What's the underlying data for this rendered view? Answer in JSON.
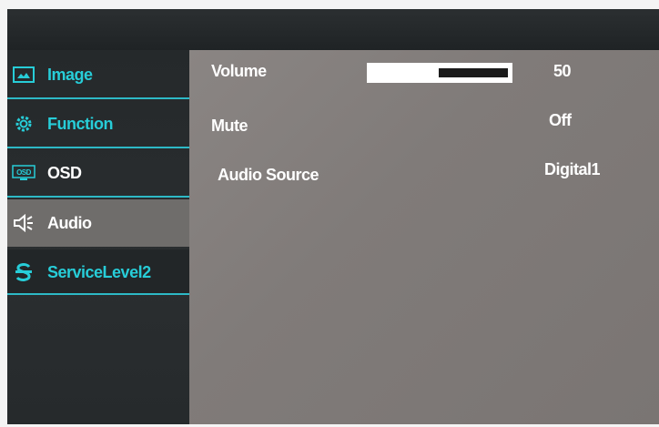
{
  "menu": {
    "items": [
      {
        "label": "Image",
        "icon": "image-icon"
      },
      {
        "label": "Function",
        "icon": "gear-icon"
      },
      {
        "label": "OSD",
        "icon": "osd-icon",
        "icon_text": "OSD"
      },
      {
        "label": "Audio",
        "icon": "speaker-icon"
      },
      {
        "label": "ServiceLevel2",
        "icon": "service-icon"
      }
    ],
    "selected": "Audio"
  },
  "audio": {
    "volume": {
      "label": "Volume",
      "value": "50",
      "level": 0.5
    },
    "mute": {
      "label": "Mute",
      "value": "Off"
    },
    "source": {
      "label": "Audio Source",
      "value": "Digital1"
    }
  },
  "colors": {
    "accent": "#27cdd8",
    "panel": "#807b79",
    "sidebar": "#25292b"
  }
}
